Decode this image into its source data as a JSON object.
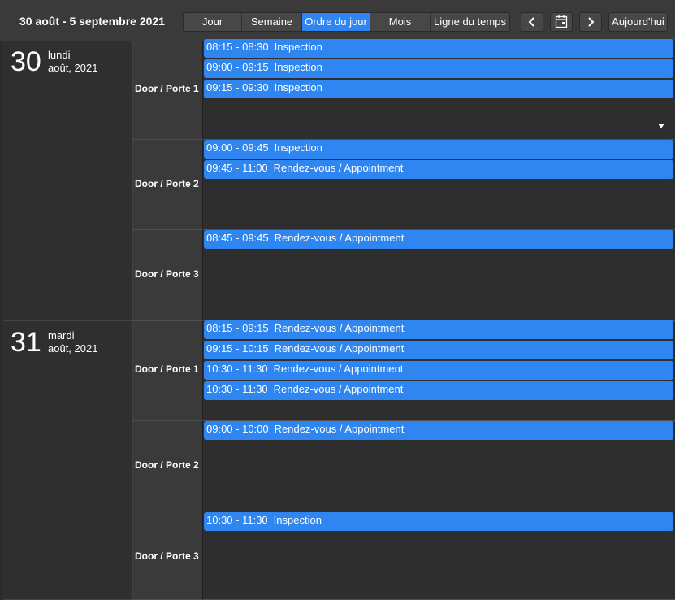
{
  "toolbar": {
    "range_title": "30 août - 5 septembre 2021",
    "views": [
      "Jour",
      "Semaine",
      "Ordre du jour",
      "Mois",
      "Ligne du temps"
    ],
    "active_view": "Ordre du jour",
    "prev_icon": "chevron-left-icon",
    "calendar_icon": "calendar-icon",
    "next_icon": "chevron-right-icon",
    "today_label": "Aujourd'hui"
  },
  "colors": {
    "accent": "#2f86f0",
    "background": "#2b2b2b",
    "toolbar": "#3a3a3a"
  },
  "days": [
    {
      "num": "30",
      "name": "lundi",
      "month": "août, 2021",
      "resources": [
        {
          "label": "Door / Porte 1",
          "has_more": true,
          "events": [
            {
              "time": "08:15 - 08:30",
              "title": "Inspection"
            },
            {
              "time": "09:00 - 09:15",
              "title": "Inspection"
            },
            {
              "time": "09:15 - 09:30",
              "title": "Inspection"
            }
          ]
        },
        {
          "label": "Door / Porte 2",
          "events": [
            {
              "time": "09:00 - 09:45",
              "title": "Inspection"
            },
            {
              "time": "09:45 - 11:00",
              "title": "Rendez-vous / Appointment"
            }
          ]
        },
        {
          "label": "Door / Porte 3",
          "events": [
            {
              "time": "08:45 - 09:45",
              "title": "Rendez-vous / Appointment"
            }
          ]
        }
      ]
    },
    {
      "num": "31",
      "name": "mardi",
      "month": "août, 2021",
      "resources": [
        {
          "label": "Door / Porte 1",
          "events": [
            {
              "time": "08:15 - 09:15",
              "title": "Rendez-vous / Appointment"
            },
            {
              "time": "09:15 - 10:15",
              "title": "Rendez-vous / Appointment"
            },
            {
              "time": "10:30 - 11:30",
              "title": "Rendez-vous / Appointment"
            },
            {
              "time": "10:30 - 11:30",
              "title": "Rendez-vous / Appointment"
            }
          ]
        },
        {
          "label": "Door / Porte 2",
          "events": [
            {
              "time": "09:00 - 10:00",
              "title": "Rendez-vous / Appointment"
            }
          ]
        },
        {
          "label": "Door / Porte 3",
          "events": [
            {
              "time": "10:30 - 11:30",
              "title": "Inspection"
            }
          ]
        }
      ]
    }
  ]
}
